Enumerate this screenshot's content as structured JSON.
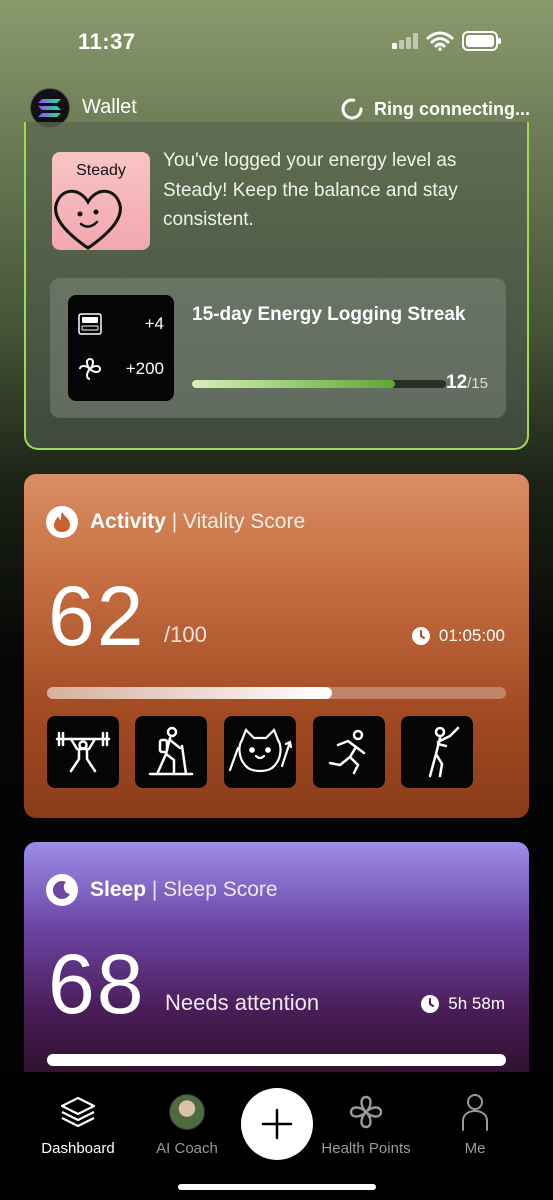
{
  "status_bar": {
    "time": "11:37"
  },
  "header": {
    "wallet_label": "Wallet",
    "ring_status": "Ring connecting..."
  },
  "energy_card": {
    "mood_badge": "Steady",
    "message": "You've logged your energy level as Steady! Keep the balance and stay consistent.",
    "rewards": {
      "points_a": "+4",
      "points_b": "+200"
    },
    "streak_title": "15-day Energy Logging Streak",
    "streak_current": "12",
    "streak_total": "/15",
    "streak_progress": 0.8
  },
  "activity_card": {
    "title": "Activity",
    "subtitle": "| Vitality Score",
    "score": "62",
    "score_max": "/100",
    "duration": "01:05:00",
    "progress": 0.62,
    "activities": [
      "weightlifting-icon",
      "hiking-icon",
      "pet-walking-icon",
      "running-icon",
      "golf-icon"
    ]
  },
  "sleep_card": {
    "title": "Sleep",
    "subtitle": "| Sleep Score",
    "score": "68",
    "status": "Needs attention",
    "duration": "5h 58m",
    "progress": 1.0
  },
  "tab_bar": {
    "tabs": [
      {
        "label": "Dashboard",
        "active": true
      },
      {
        "label": "AI Coach",
        "active": false
      },
      {
        "label": "Health Points",
        "active": false
      },
      {
        "label": "Me",
        "active": false
      }
    ]
  },
  "colors": {
    "accent_green": "#9fdc4c",
    "activity": "#c26a3e",
    "sleep": "#6d46a6"
  }
}
